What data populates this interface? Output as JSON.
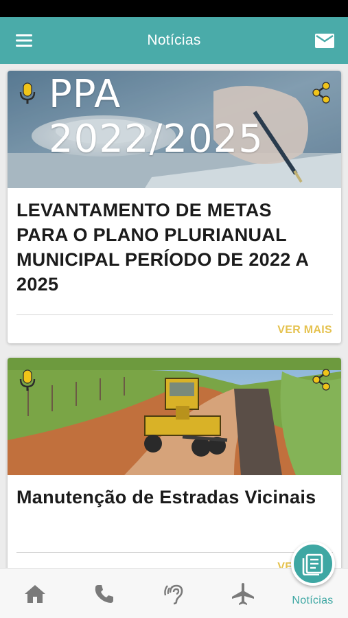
{
  "app_bar": {
    "title": "Notícias",
    "menu_icon": "menu-icon",
    "mail_icon": "mail-icon",
    "color": "#4aaba9"
  },
  "news": [
    {
      "image_text": "PPA 2022/2025",
      "title": "LEVANTAMENTO DE METAS PARA O PLANO PLURIANUAL MUNICIPAL PERÍODO DE 2022 A 2025",
      "link_label": "VER MAIS"
    },
    {
      "image_text": "",
      "title": "Manutenção de Estradas Vicinais",
      "link_label": "VER MAIS"
    }
  ],
  "bottom_nav": {
    "items": [
      {
        "icon": "home-icon"
      },
      {
        "icon": "phone-icon"
      },
      {
        "icon": "hearing-icon"
      },
      {
        "icon": "airplane-icon"
      },
      {
        "icon": "news-icon",
        "label": "Notícias",
        "active": true
      }
    ],
    "active_color": "#3ea7a3"
  },
  "colors": {
    "accent": "#e5c24f",
    "primary": "#4aaba9"
  }
}
